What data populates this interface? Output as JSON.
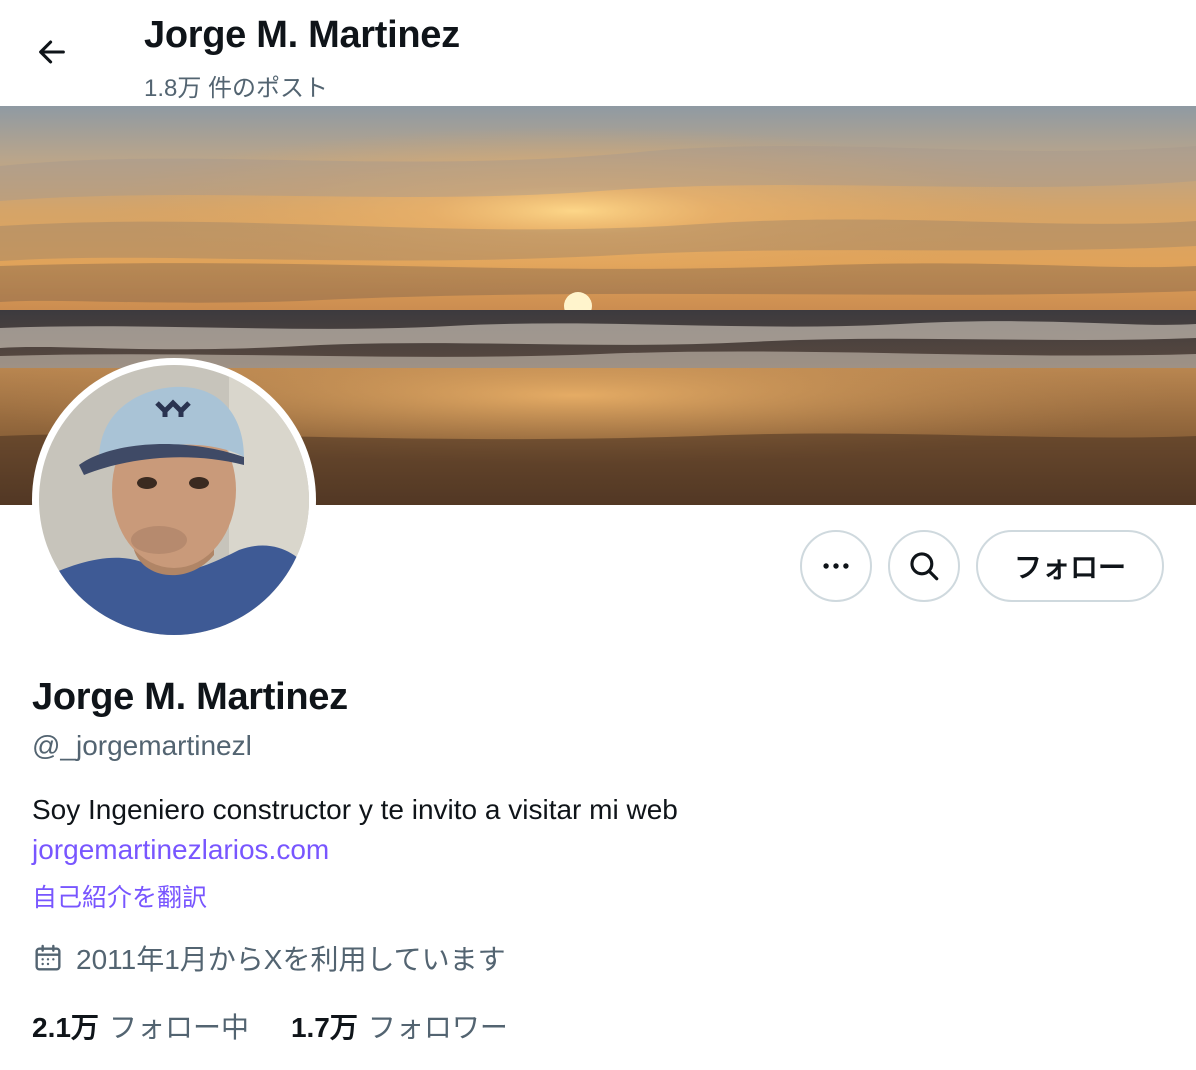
{
  "header": {
    "title": "Jorge M. Martinez",
    "post_count": "1.8万 件のポスト",
    "back_icon": "arrow-left-icon"
  },
  "actions": {
    "more_icon": "more-dots-icon",
    "search_icon": "search-icon",
    "follow_label": "フォロー"
  },
  "profile": {
    "name": "Jorge M. Martinez",
    "handle": "@_jorgemartinezl",
    "bio": "Soy Ingeniero constructor y te invito a visitar mi web",
    "link": "jorgemartinezlarios.com",
    "translate_label": "自己紹介を翻訳",
    "joined": "2011年1月からXを利用しています",
    "joined_icon": "calendar-icon"
  },
  "stats": {
    "following_count": "2.1万",
    "following_label": "フォロー中",
    "followers_count": "1.7万",
    "followers_label": "フォロワー"
  },
  "colors": {
    "text": "#0f1419",
    "secondary": "#536471",
    "link": "#7856ff",
    "border": "#cfd9de"
  }
}
